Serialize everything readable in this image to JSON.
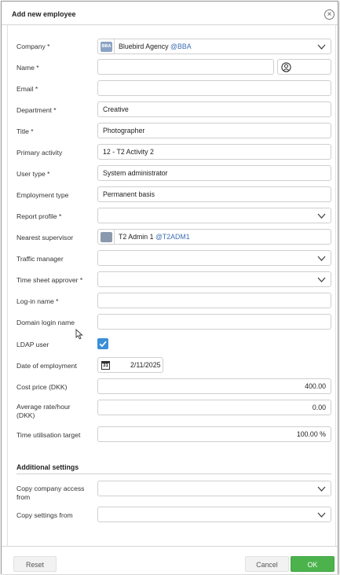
{
  "dialog": {
    "title": "Add new employee",
    "close_icon": "close-circle-icon"
  },
  "form": {
    "company": {
      "label": "Company *",
      "tag": "BBA",
      "tag_color": "#8aa3c4",
      "value": "Bluebird Agency",
      "handle": "@BBA"
    },
    "name": {
      "label": "Name *",
      "value": "",
      "initials": "",
      "avatar_icon": "user-circle-icon"
    },
    "email": {
      "label": "Email *",
      "value": ""
    },
    "department": {
      "label": "Department *",
      "value": "Creative"
    },
    "title": {
      "label": "Title *",
      "value": "Photographer"
    },
    "primary_activity": {
      "label": "Primary activity",
      "value": "12 - T2 Activity 2"
    },
    "user_type": {
      "label": "User type *",
      "value": "System administrator"
    },
    "employment_type": {
      "label": "Employment type",
      "value": "Permanent basis"
    },
    "report_profile": {
      "label": "Report profile *",
      "value": ""
    },
    "nearest_supervisor": {
      "label": "Nearest supervisor",
      "value": "T2 Admin 1",
      "handle": "@T2ADM1",
      "avatar_color": "#8a99ad"
    },
    "traffic_manager": {
      "label": "Traffic manager",
      "value": ""
    },
    "time_sheet_approver": {
      "label": "Time sheet approver *",
      "value": ""
    },
    "login_name": {
      "label": "Log-in name *",
      "value": ""
    },
    "domain_login_name": {
      "label": "Domain login name",
      "value": ""
    },
    "ldap_user": {
      "label": "LDAP user",
      "checked": true
    },
    "date_of_employment": {
      "label": "Date of employment",
      "value": "2/11/2025",
      "icon": "calendar-icon",
      "icon_text": "31"
    },
    "cost_price": {
      "label": "Cost price (DKK)",
      "value": "400.00"
    },
    "average_rate": {
      "label_line1": "Average rate/hour",
      "label_line2": "(DKK)",
      "value": "0.00"
    },
    "time_utilisation": {
      "label": "Time utilisation target",
      "value": "100.00 %"
    }
  },
  "additional": {
    "title": "Additional settings",
    "copy_company_access": {
      "label_line1": "Copy company access",
      "label_line2": "from",
      "value": ""
    },
    "copy_settings": {
      "label": "Copy settings from",
      "value": ""
    }
  },
  "footer": {
    "reset_label": "Reset",
    "cancel_label": "Cancel",
    "ok_label": "OK",
    "ok_color": "#4cb34c"
  }
}
